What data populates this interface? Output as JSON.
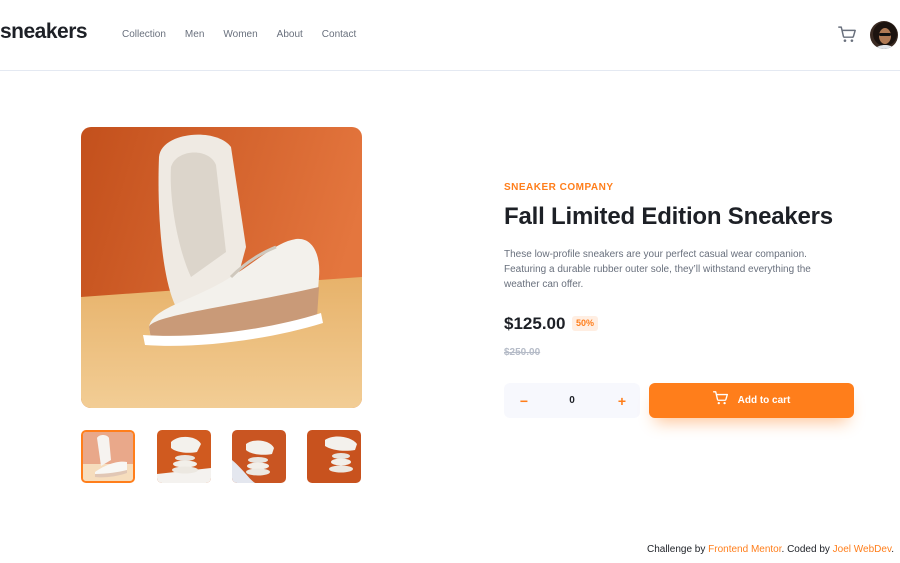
{
  "header": {
    "logo": "sneakers",
    "nav": [
      "Collection",
      "Men",
      "Women",
      "About",
      "Contact"
    ]
  },
  "product": {
    "company": "SNEAKER COMPANY",
    "title": "Fall Limited Edition Sneakers",
    "description": "These low-profile sneakers are your perfect casual wear companion. Featuring a durable rubber outer sole, they’ll withstand everything the weather can offer.",
    "price": "$125.00",
    "discount": "50%",
    "old_price": "$250.00",
    "quantity": "0",
    "minus_label": "−",
    "plus_label": "+",
    "add_to_cart": "Add to cart"
  },
  "footer": {
    "prefix": "Challenge by ",
    "link1": "Frontend Mentor",
    "middle": ". Coded by ",
    "link2": "Joel WebDev",
    "suffix": "."
  },
  "colors": {
    "accent": "#ff7e1b",
    "accent_pale": "#ffeee2",
    "text_dark": "#1d2026",
    "text_gray": "#69707d"
  },
  "icons": [
    "cart-icon",
    "avatar"
  ]
}
